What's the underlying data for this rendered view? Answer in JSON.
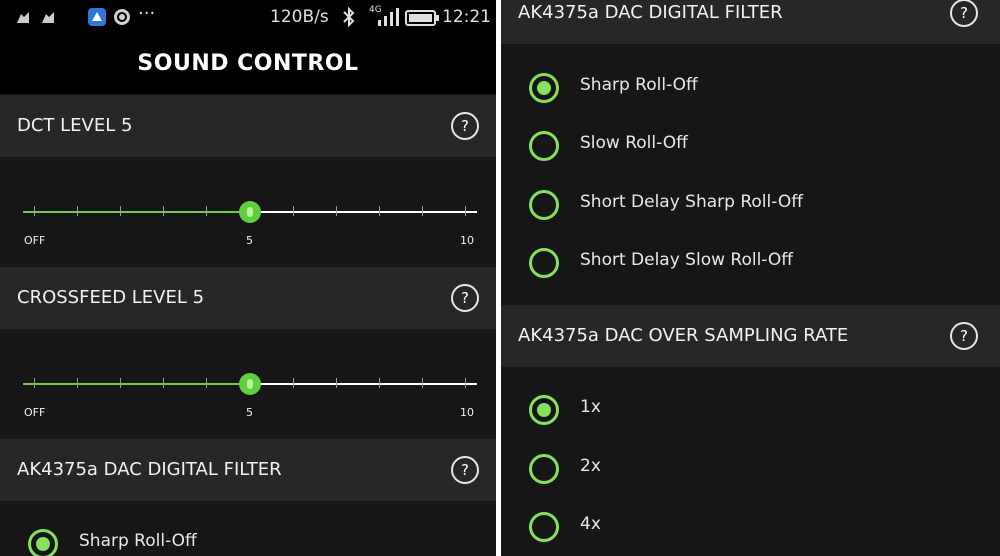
{
  "status": {
    "speed": "120B/s",
    "network": "4G",
    "time": "12:21",
    "icons": [
      "notification-icon",
      "notification-icon",
      "app-icon",
      "sync-icon",
      "more-icon",
      "bluetooth-icon",
      "signal-icon",
      "battery-icon"
    ],
    "more": "···"
  },
  "app": {
    "title": "SOUND CONTROL"
  },
  "help_symbol": "?",
  "dct": {
    "label": "DCT LEVEL  5",
    "value": 5,
    "min_label": "OFF",
    "mid_label": "5",
    "max_label": "10"
  },
  "crossfeed": {
    "label": "CROSSFEED LEVEL  5",
    "value": 5,
    "min_label": "OFF",
    "mid_label": "5",
    "max_label": "10"
  },
  "digital_filter": {
    "label": "AK4375a DAC DIGITAL FILTER",
    "options": [
      "Sharp Roll-Off",
      "Slow Roll-Off",
      "Short Delay Sharp Roll-Off",
      "Short Delay Slow Roll-Off"
    ],
    "selected": "Sharp Roll-Off"
  },
  "oversampling": {
    "label": "AK4375a DAC OVER SAMPLING RATE",
    "options": [
      "1x",
      "2x",
      "4x"
    ],
    "selected": "1x"
  },
  "colors": {
    "accent": "#86e05c",
    "header_bg": "#272727",
    "body_bg": "#161616"
  }
}
